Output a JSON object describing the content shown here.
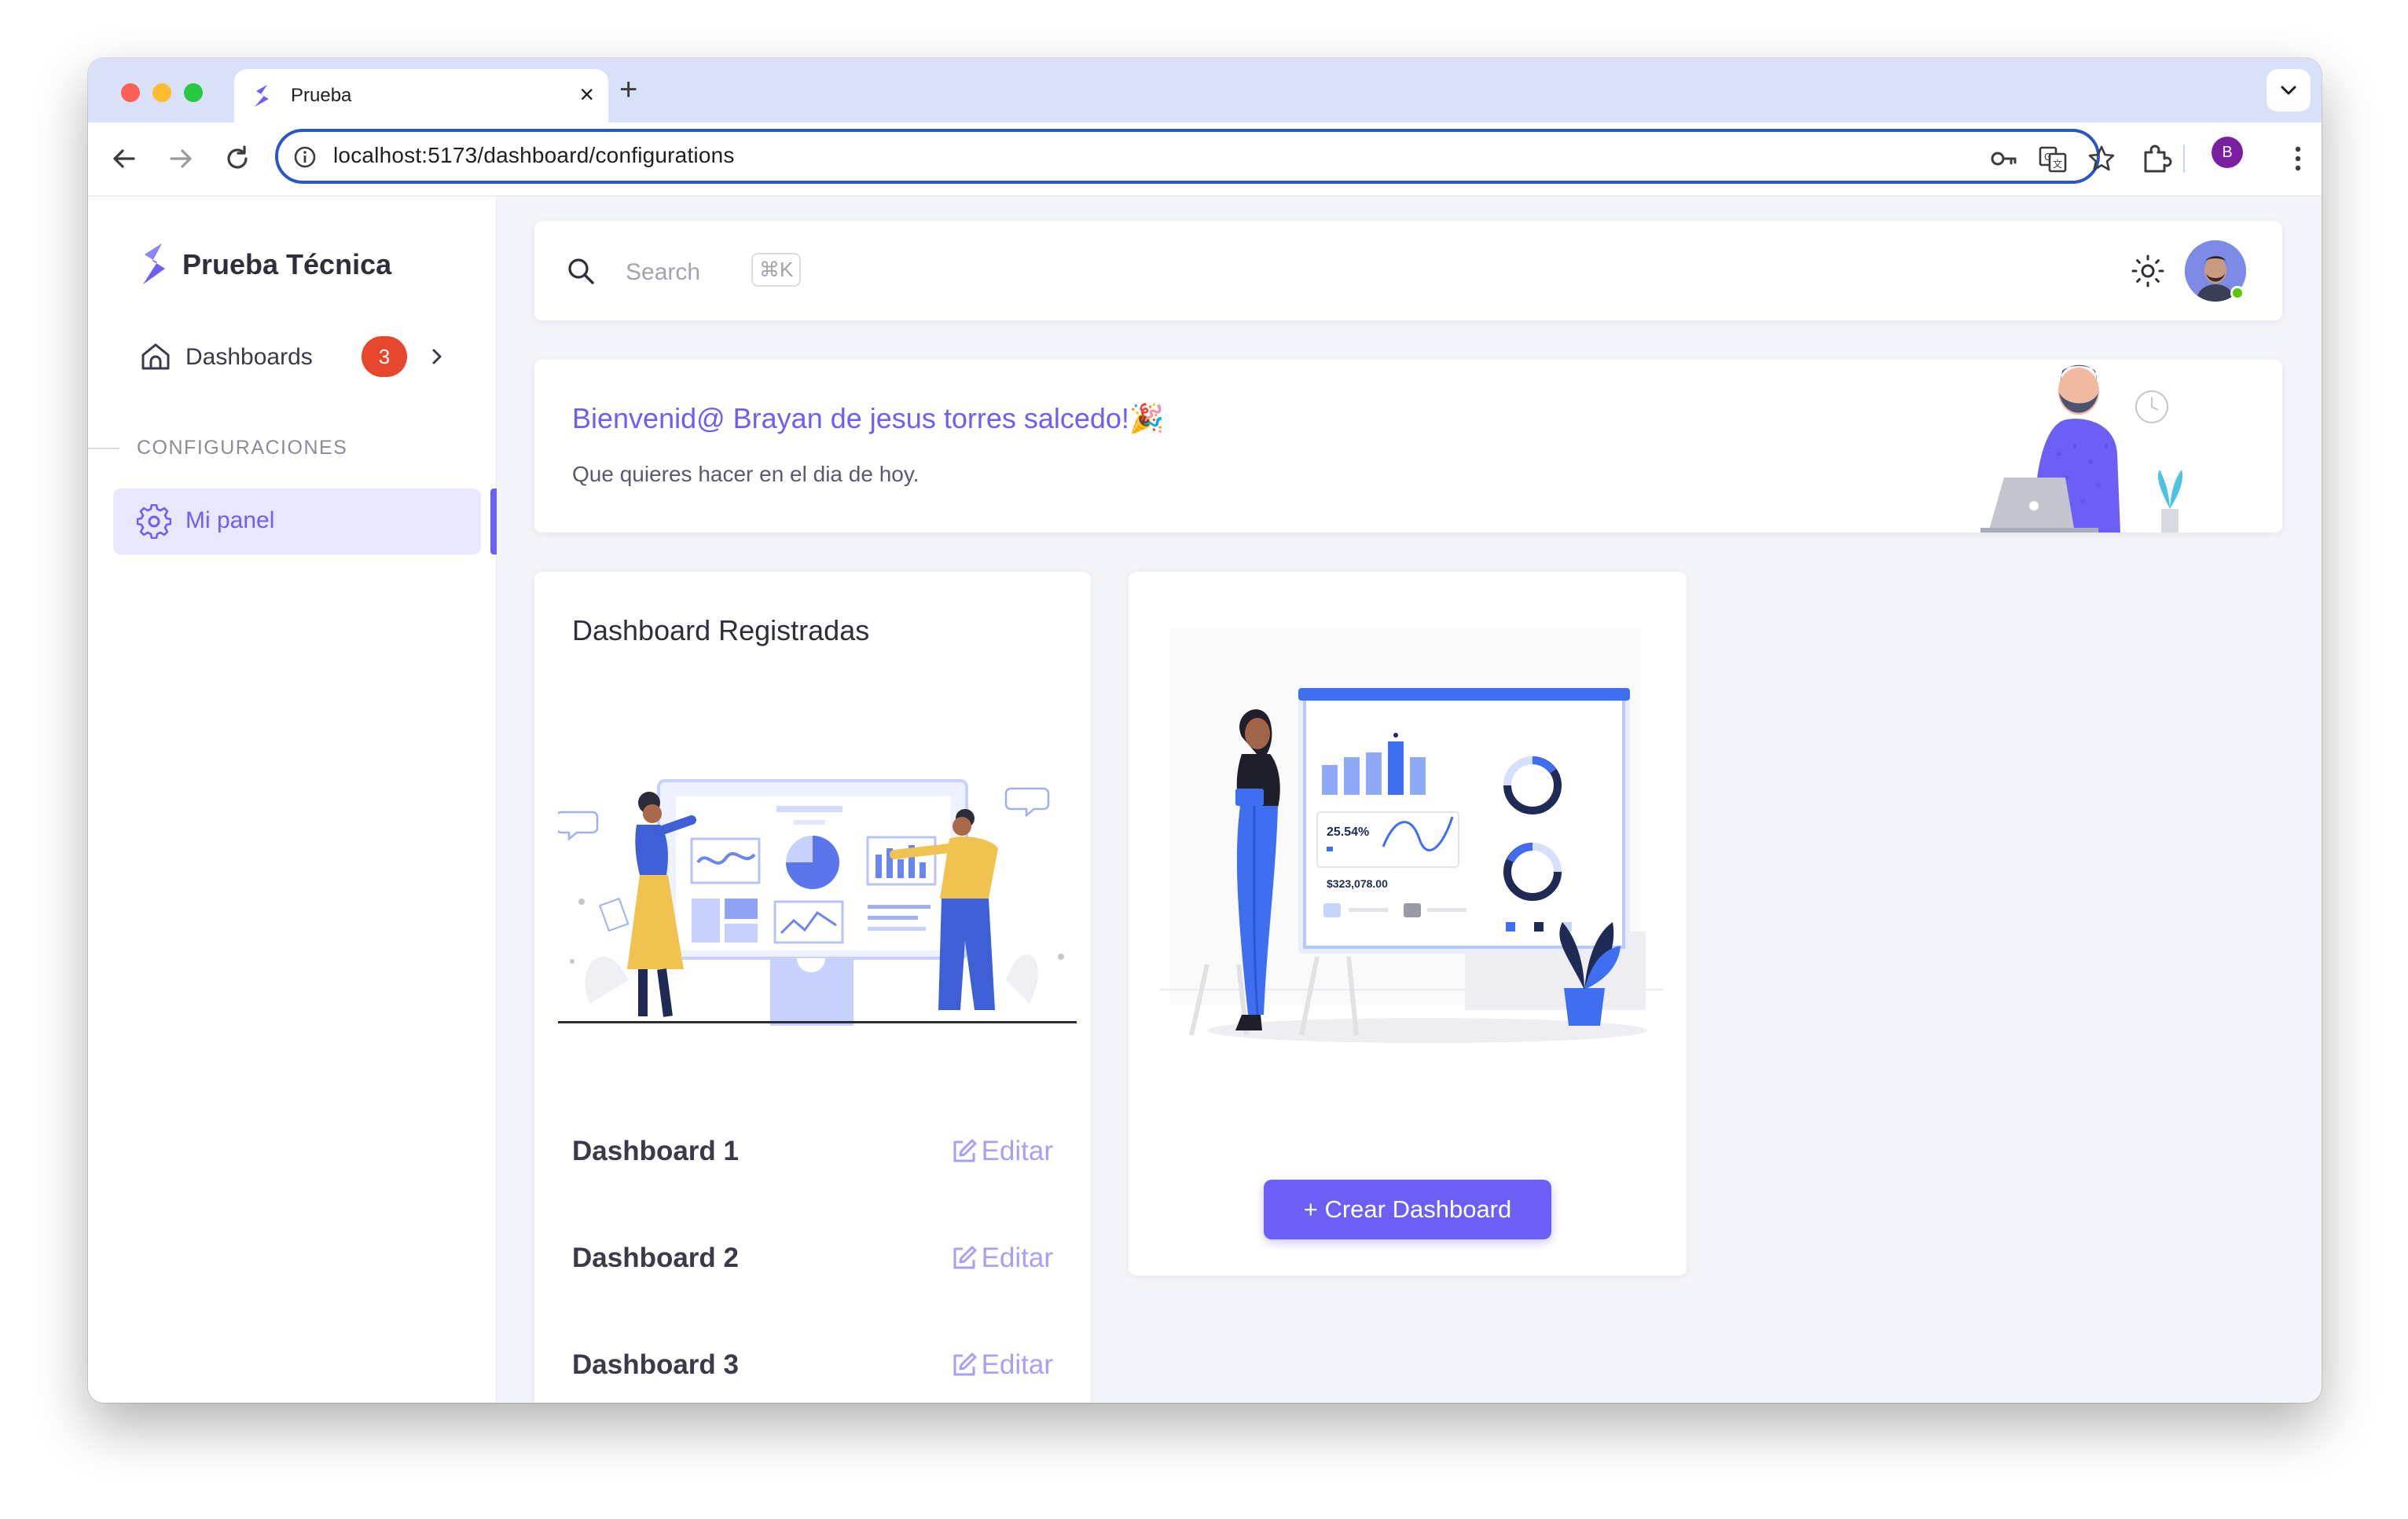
{
  "browser": {
    "tab_title": "Prueba",
    "tab_close": "×",
    "new_tab": "+",
    "url": "localhost:5173/dashboard/configurations",
    "profile_initial": "B"
  },
  "sidebar": {
    "brand": "Prueba Técnica",
    "nav": {
      "label": "Dashboards",
      "badge": "3"
    },
    "section_title": "CONFIGURACIONES",
    "menu": [
      {
        "label": "Mi panel",
        "icon": "gear-icon",
        "active": true
      }
    ]
  },
  "topbar": {
    "search_placeholder": "Search",
    "shortcut": "⌘K"
  },
  "welcome": {
    "title": "Bienvenid@ Brayan de jesus torres salcedo!🎉",
    "subtitle": "Que quieres hacer en el dia de hoy."
  },
  "registered": {
    "title": "Dashboard Registradas",
    "edit_label": "Editar",
    "items": [
      {
        "name": "Dashboard 1"
      },
      {
        "name": "Dashboard 2"
      },
      {
        "name": "Dashboard 3"
      }
    ]
  },
  "create": {
    "button_label": "+ Crear Dashboard",
    "stat_percent": "25.54%",
    "stat_amount": "$323,078.00"
  },
  "colors": {
    "primary": "#6d5ff5",
    "badge": "#e8472f",
    "illustration_blue": "#3f6ff0"
  }
}
